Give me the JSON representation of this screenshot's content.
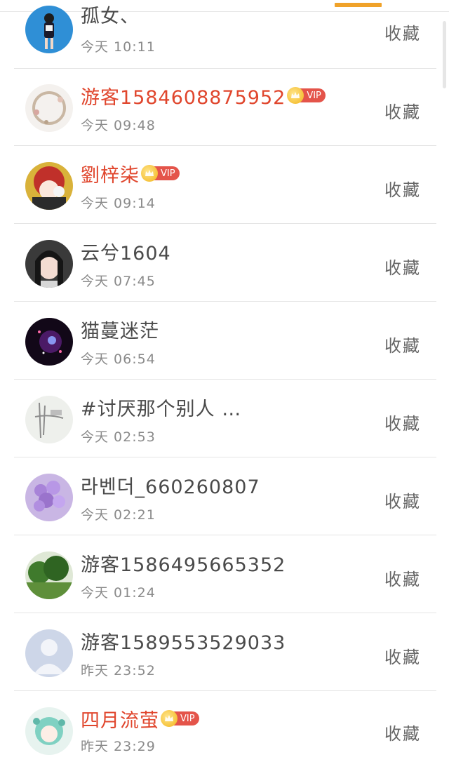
{
  "fav_label": "收藏",
  "vip_label": "VIP",
  "colors": {
    "accent": "#f0a229",
    "vip_name": "#e0462d",
    "vip_badge": "#e4544a"
  },
  "items": [
    {
      "name": "孤女、",
      "time": "今天 10:11",
      "vip": false,
      "avatar": "girl-standing-photo"
    },
    {
      "name": "游客1584608875952",
      "time": "今天 09:48",
      "vip": true,
      "avatar": "floral-wreath"
    },
    {
      "name": "劉梓柒",
      "time": "今天 09:14",
      "vip": true,
      "avatar": "red-hair-anime"
    },
    {
      "name": "云兮1604",
      "time": "今天 07:45",
      "vip": false,
      "avatar": "girl-portrait"
    },
    {
      "name": "猫蔓迷茫",
      "time": "今天 06:54",
      "vip": false,
      "avatar": "galaxy"
    },
    {
      "name": "#讨厌那个别人 …",
      "time": "今天 02:53",
      "vip": false,
      "avatar": "sketch-text"
    },
    {
      "name": "라벤더_660260807",
      "time": "今天 02:21",
      "vip": false,
      "avatar": "lavender-bouquet"
    },
    {
      "name": "游客1586495665352",
      "time": "今天 01:24",
      "vip": false,
      "avatar": "forest"
    },
    {
      "name": "游客1589553529033",
      "time": "昨天 23:52",
      "vip": false,
      "avatar": "default-user"
    },
    {
      "name": "四月流萤",
      "time": "昨天 23:29",
      "vip": true,
      "avatar": "green-hair-anime"
    }
  ]
}
